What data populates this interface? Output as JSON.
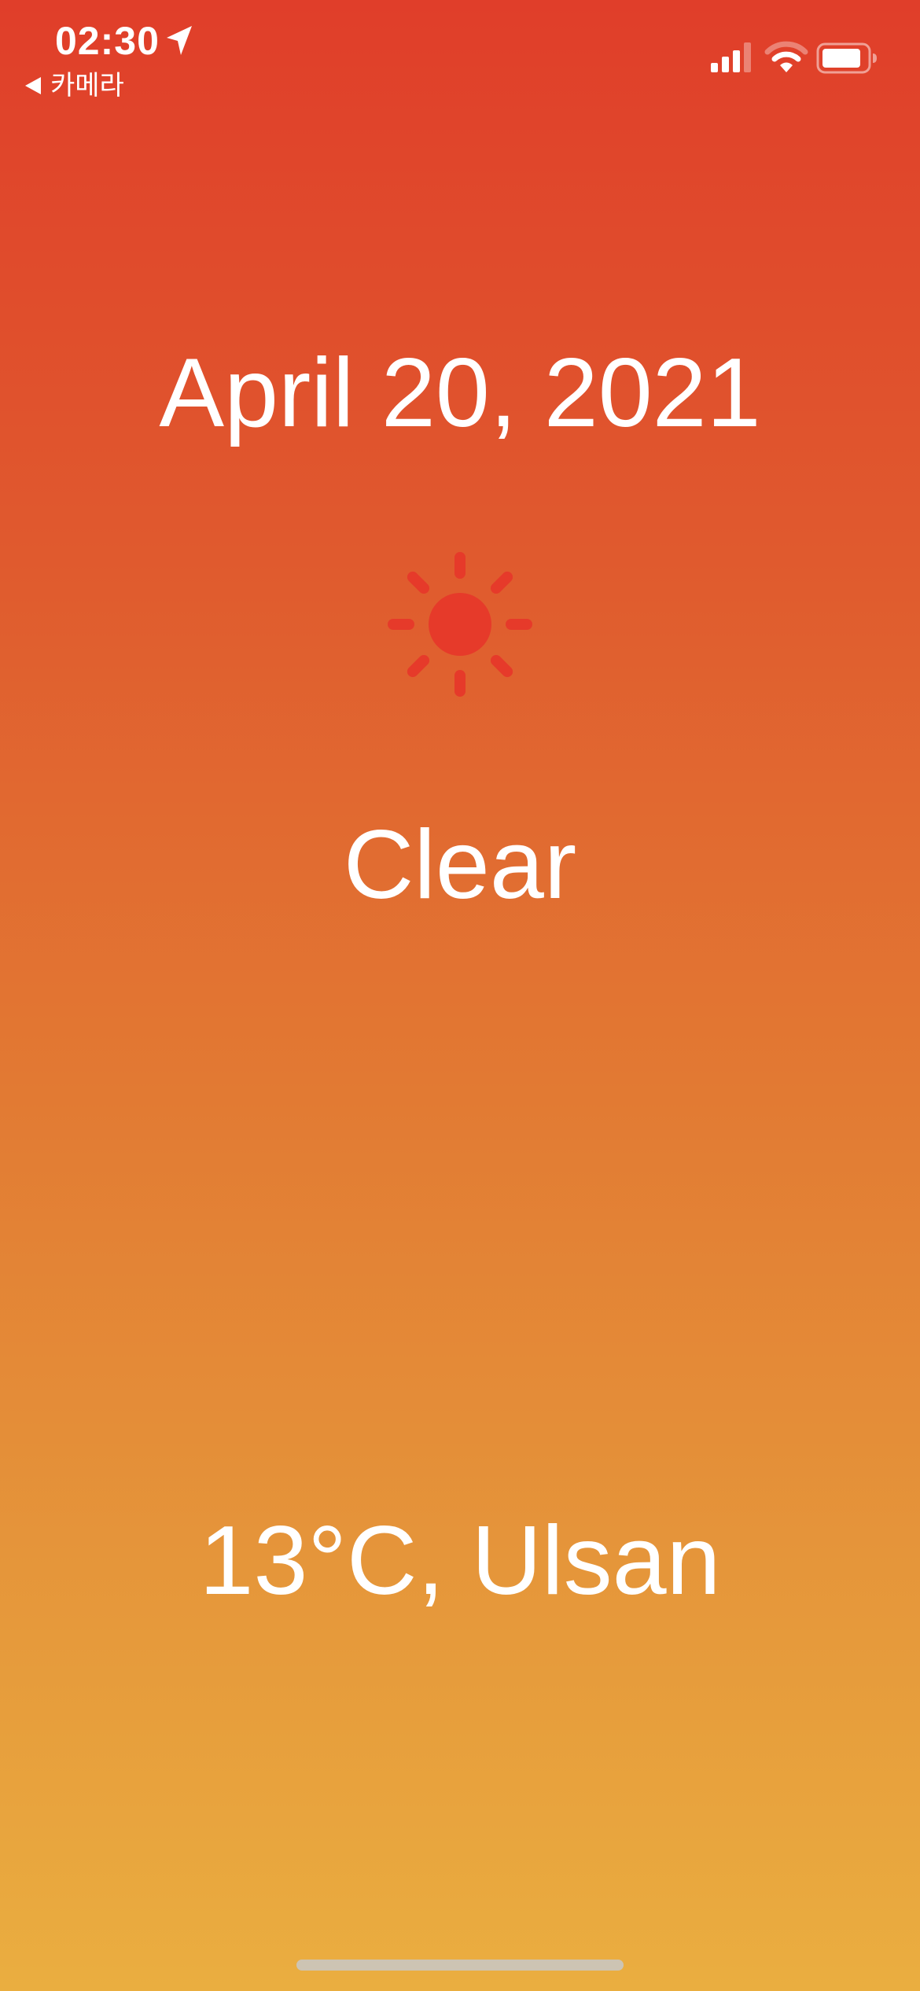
{
  "status_bar": {
    "time": "02:30",
    "back_label": "카메라",
    "icons": [
      "location-arrow-icon",
      "signal-icon",
      "wifi-icon",
      "battery-icon"
    ]
  },
  "weather": {
    "date": "April 20, 2021",
    "condition": "Clear",
    "condition_icon": "sun-icon",
    "temperature_location": "13°C, Ulsan"
  },
  "colors": {
    "gradient_top": "#E03E2A",
    "gradient_bottom": "#EAAE40",
    "sun": "#E63A2A",
    "text": "#FFFFFF"
  }
}
